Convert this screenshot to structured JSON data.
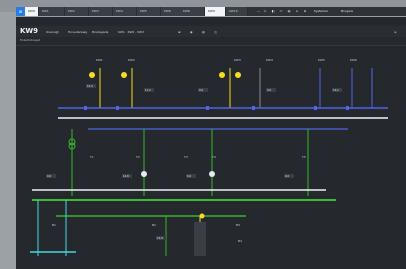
{
  "app": {
    "logo": "⊞"
  },
  "tabs": [
    {
      "label": "KW9"
    },
    {
      "label": "KW1"
    },
    {
      "label": "KW2"
    },
    {
      "label": "KW3"
    },
    {
      "label": "KW4"
    },
    {
      "label": "KW5"
    },
    {
      "label": "KW6"
    },
    {
      "label": "KW7"
    },
    {
      "label": "KW8"
    },
    {
      "label": "KW9"
    },
    {
      "label": "KW10"
    }
  ],
  "toolbar": {
    "items": [
      {
        "label": "—"
      },
      {
        "label": "⚠"
      },
      {
        "label": "◧"
      },
      {
        "label": "▭"
      },
      {
        "label": "▤"
      },
      {
        "label": "⌂"
      },
      {
        "label": "⊕"
      },
      {
        "label": "Systemer"
      },
      {
        "label": "Brugere"
      }
    ]
  },
  "header": {
    "title": "KW9",
    "fields": [
      {
        "label": "Oversigt"
      },
      {
        "label": "Hovedanlæg"
      },
      {
        "label": "Bredegade"
      },
      {
        "label": "KW1 · KW2 · KW3"
      }
    ],
    "icons": [
      "⊞",
      "◉",
      "▤",
      "◫"
    ],
    "right_label": "≡"
  },
  "breadcrumb": "Enkeltstreget",
  "colors": {
    "busbar_blue": "#4f64e6",
    "busbar_green": "#3fd035",
    "busbar_white": "#f2f4f6",
    "feeder_yellow": "#f5dd1f",
    "cyan": "#43d7e0",
    "breaker_green": "#35b82a"
  },
  "diagram": {
    "top_feeders": [
      {
        "label": "KW1"
      },
      {
        "label": "KW2"
      },
      {
        "label": "KW3"
      },
      {
        "label": "KW4"
      },
      {
        "label": "KW5"
      },
      {
        "label": "KW6"
      },
      {
        "label": "KW7"
      },
      {
        "label": "KW8"
      },
      {
        "label": "KW9"
      },
      {
        "label": "KW10"
      }
    ],
    "value_tags": [
      {
        "text": "10,4"
      },
      {
        "text": "11,2"
      },
      {
        "text": "0,0"
      },
      {
        "text": "0,0"
      },
      {
        "text": "10,2"
      },
      {
        "text": "0,0"
      },
      {
        "text": "10,8"
      },
      {
        "text": "0,0"
      },
      {
        "text": "0,0"
      },
      {
        "text": "10,9"
      }
    ],
    "mid_labels": [
      {
        "text": "T1"
      },
      {
        "text": "T2"
      },
      {
        "text": "T3"
      },
      {
        "text": "T4"
      },
      {
        "text": "T5"
      }
    ],
    "bottom_labels": [
      {
        "text": "B1"
      },
      {
        "text": "B2"
      },
      {
        "text": "B3"
      },
      {
        "text": "B4"
      }
    ]
  }
}
